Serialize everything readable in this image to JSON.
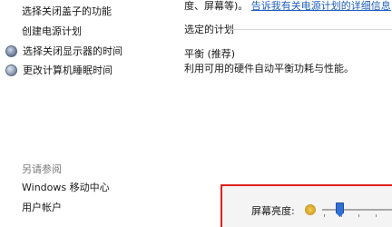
{
  "nav": {
    "items": [
      {
        "label": "选择关闭盖子的功能",
        "icon": ""
      },
      {
        "label": "创建电源计划",
        "icon": ""
      },
      {
        "label": "选择关闭显示器的时间",
        "icon": "monitor-shield-icon"
      },
      {
        "label": "更改计算机睡眠时间",
        "icon": "sleep-moon-icon"
      }
    ],
    "see_also_title": "另请参阅",
    "see_also_links": [
      "Windows 移动中心",
      "用户帐户"
    ]
  },
  "main": {
    "top_prefix": "度、屏幕等)。",
    "top_link": "告诉我有关电源计划的详细信息",
    "section_title": "选定的计划",
    "plan_name": "平衡 (推荐)",
    "plan_desc": "利用可用的硬件自动平衡功耗与性能。"
  },
  "brightness": {
    "label": "屏幕亮度:",
    "icon": "sun-brightness-icon",
    "value_percent": 25
  },
  "colors": {
    "highlight_border": "#e0201c",
    "link": "#1f5fbf",
    "slider_thumb": "#2f6fd6"
  }
}
